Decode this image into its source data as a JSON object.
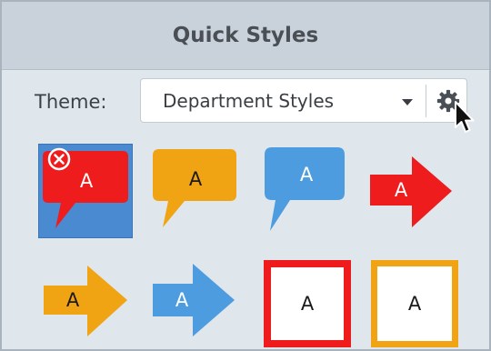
{
  "panel": {
    "title": "Quick Styles"
  },
  "theme": {
    "label": "Theme:",
    "selected": "Department Styles"
  },
  "icons": {
    "settings": "gear-icon",
    "dropdown": "caret-down-icon",
    "remove": "remove-x-icon",
    "pointer": "mouse-pointer-icon"
  },
  "styles": [
    {
      "name": "red-speech-bubble",
      "text": "A",
      "fill": "#ee1c1c",
      "text_color": "#ffffff",
      "selected": true
    },
    {
      "name": "orange-speech-bubble",
      "text": "A",
      "fill": "#f0a313",
      "text_color": "#1a1a1a",
      "selected": false
    },
    {
      "name": "blue-speech-bubble",
      "text": "A",
      "fill": "#4e9ce0",
      "text_color": "#ffffff",
      "selected": false
    },
    {
      "name": "red-arrow",
      "text": "A",
      "fill": "#ee1c1c",
      "text_color": "#ffffff",
      "selected": false
    },
    {
      "name": "orange-arrow",
      "text": "A",
      "fill": "#f0a313",
      "text_color": "#1a1a1a",
      "selected": false
    },
    {
      "name": "blue-arrow",
      "text": "A",
      "fill": "#4e9ce0",
      "text_color": "#ffffff",
      "selected": false
    },
    {
      "name": "red-outline-box",
      "text": "A",
      "fill": "#ee1c1c",
      "text_color": "#1a1a1a",
      "selected": false
    },
    {
      "name": "orange-outline-box",
      "text": "A",
      "fill": "#f0a313",
      "text_color": "#1a1a1a",
      "selected": false
    }
  ],
  "colors": {
    "selection": "#4a8ad0",
    "header_bg": "#c9d2da",
    "panel_bg": "#dfe6ec"
  }
}
